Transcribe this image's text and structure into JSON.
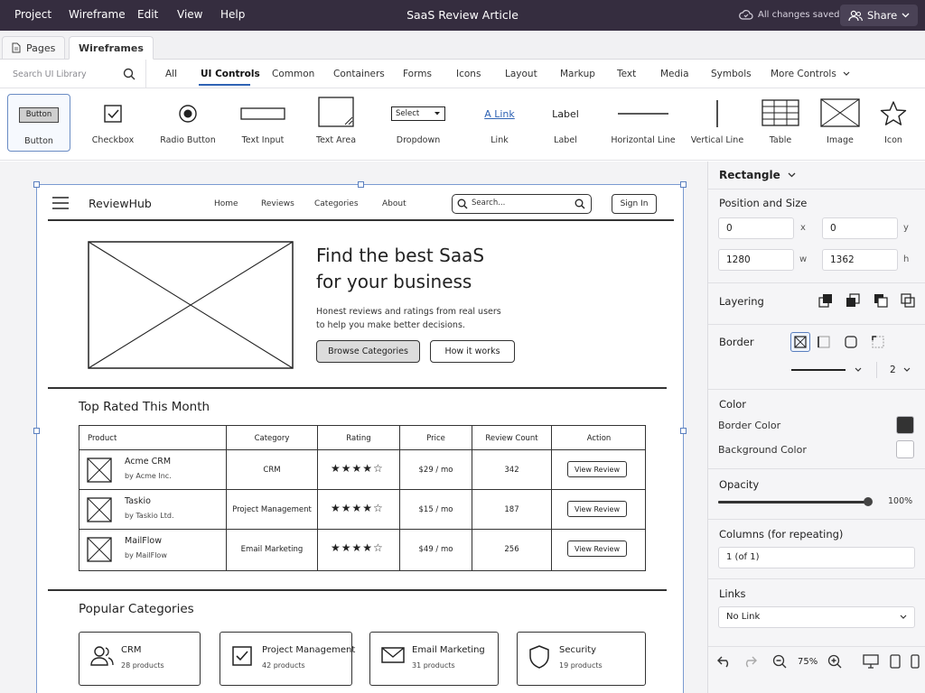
{
  "colors": {
    "menubar_bg": "#352d3f",
    "accent": "#2f63b4",
    "selection": "#7b9bd1",
    "border_color_swatch": "#333333",
    "background_color_swatch": "#ffffff"
  },
  "menubar": {
    "items": [
      "Project",
      "Wireframe",
      "Edit",
      "View",
      "Help"
    ],
    "title": "SaaS Review Article",
    "saved_status": "All changes saved",
    "share_label": "Share"
  },
  "page_tabs": [
    "Pages",
    "Wireframes"
  ],
  "library": {
    "search_placeholder": "Search UI Library",
    "categories": [
      "All",
      "UI Controls",
      "Common",
      "Containers",
      "Forms",
      "Icons",
      "Layout",
      "Markup",
      "Text",
      "Media",
      "Symbols",
      "More Controls"
    ],
    "active_category": "UI Controls"
  },
  "palette": {
    "items": [
      "Button",
      "Checkbox",
      "Radio Button",
      "Text Input",
      "Text Area",
      "Dropdown",
      "Link",
      "Label",
      "Horizontal Line",
      "Vertical Line",
      "Table",
      "Image",
      "Icon"
    ],
    "button_preview": "Button",
    "dropdown_preview": "Select",
    "link_preview": "A Link",
    "label_preview": "Label"
  },
  "wireframe": {
    "brand": "ReviewHub",
    "nav": [
      "Home",
      "Reviews",
      "Categories",
      "About"
    ],
    "search_placeholder": "Search...",
    "signin": "Sign In",
    "hero_title_line1": "Find the best SaaS",
    "hero_title_line2": "for your business",
    "hero_sub_line1": "Honest reviews and ratings from real users",
    "hero_sub_line2": "to help you make better decisions.",
    "hero_primary": "Browse Categories",
    "hero_secondary": "How it works",
    "top_rated_title": "Top Rated This Month",
    "table_headers": [
      "Product",
      "Category",
      "Rating",
      "Price",
      "Review Count",
      "Action"
    ],
    "rows": [
      {
        "name": "Acme CRM",
        "by": "by Acme Inc.",
        "category": "CRM",
        "rating": 4,
        "stars": "★★★★☆",
        "price": "$29 / mo",
        "reviews": "342",
        "action": "View Review"
      },
      {
        "name": "Taskio",
        "by": "by Taskio Ltd.",
        "category": "Project Management",
        "rating": 4,
        "stars": "★★★★☆",
        "price": "$15 / mo",
        "reviews": "187",
        "action": "View Review"
      },
      {
        "name": "MailFlow",
        "by": "by MailFlow",
        "category": "Email Marketing",
        "rating": 4,
        "stars": "★★★★☆",
        "price": "$49 / mo",
        "reviews": "256",
        "action": "View Review"
      }
    ],
    "popular_title": "Popular Categories",
    "categories": [
      {
        "name": "CRM",
        "count": "28 products",
        "icon": "users-icon"
      },
      {
        "name": "Project Management",
        "count": "42 products",
        "icon": "checkbox-icon"
      },
      {
        "name": "Email Marketing",
        "count": "31 products",
        "icon": "envelope-icon"
      },
      {
        "name": "Security",
        "count": "19 products",
        "icon": "shield-icon"
      }
    ]
  },
  "properties": {
    "shape": "Rectangle",
    "position_title": "Position and Size",
    "x": "0",
    "y": "0",
    "w": "1280",
    "h": "1362",
    "x_label": "x",
    "y_label": "y",
    "w_label": "w",
    "h_label": "h",
    "layering_title": "Layering",
    "border_title": "Border",
    "border_width": "2",
    "color_title": "Color",
    "border_color_label": "Border Color",
    "background_color_label": "Background Color",
    "opacity_title": "Opacity",
    "opacity_value": "100%",
    "opacity_fraction": 1.0,
    "columns_title": "Columns (for repeating)",
    "columns_value": "1 (of 1)",
    "links_title": "Links",
    "links_value": "No Link",
    "zoom": "75%"
  }
}
